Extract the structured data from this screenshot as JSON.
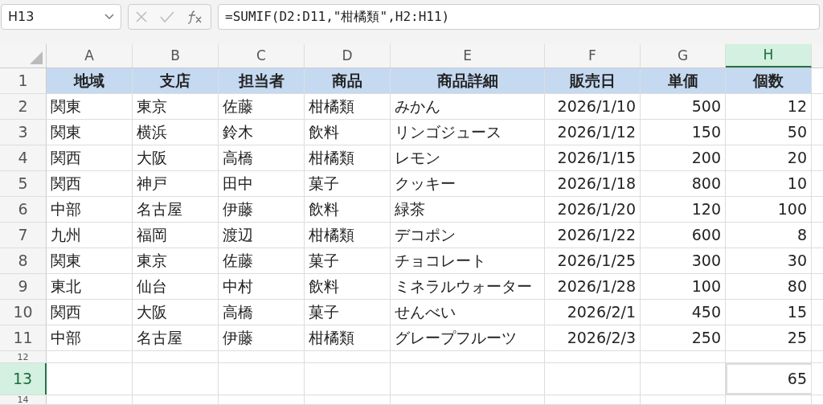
{
  "name_box": "H13",
  "formula_bar": {
    "cancel_enabled": false,
    "formula": "=SUMIF(D2:D11,\"柑橘類\",H2:H11)"
  },
  "columns": [
    {
      "letter": "A",
      "selected": false,
      "kind": "text"
    },
    {
      "letter": "B",
      "selected": false,
      "kind": "text"
    },
    {
      "letter": "C",
      "selected": false,
      "kind": "text"
    },
    {
      "letter": "D",
      "selected": false,
      "kind": "text"
    },
    {
      "letter": "E",
      "selected": false,
      "kind": "text"
    },
    {
      "letter": "F",
      "selected": false,
      "kind": "number"
    },
    {
      "letter": "G",
      "selected": false,
      "kind": "number"
    },
    {
      "letter": "H",
      "selected": true,
      "kind": "number"
    }
  ],
  "rows": [
    {
      "number": "1",
      "selected": false,
      "kind": "header",
      "cells": [
        "地域",
        "支店",
        "担当者",
        "商品",
        "商品詳細",
        "販売日",
        "単価",
        "個数"
      ]
    },
    {
      "number": "2",
      "selected": false,
      "kind": "data",
      "cells": [
        "関東",
        "東京",
        "佐藤",
        "柑橘類",
        "みかん",
        "2026/1/10",
        "500",
        "12"
      ]
    },
    {
      "number": "3",
      "selected": false,
      "kind": "data",
      "cells": [
        "関東",
        "横浜",
        "鈴木",
        "飲料",
        "リンゴジュース",
        "2026/1/12",
        "150",
        "50"
      ]
    },
    {
      "number": "4",
      "selected": false,
      "kind": "data",
      "cells": [
        "関西",
        "大阪",
        "高橋",
        "柑橘類",
        "レモン",
        "2026/1/15",
        "200",
        "20"
      ]
    },
    {
      "number": "5",
      "selected": false,
      "kind": "data",
      "cells": [
        "関西",
        "神戸",
        "田中",
        "菓子",
        "クッキー",
        "2026/1/18",
        "800",
        "10"
      ]
    },
    {
      "number": "6",
      "selected": false,
      "kind": "data",
      "cells": [
        "中部",
        "名古屋",
        "伊藤",
        "飲料",
        "緑茶",
        "2026/1/20",
        "120",
        "100"
      ]
    },
    {
      "number": "7",
      "selected": false,
      "kind": "data",
      "cells": [
        "九州",
        "福岡",
        "渡辺",
        "柑橘類",
        "デコポン",
        "2026/1/22",
        "600",
        "8"
      ]
    },
    {
      "number": "8",
      "selected": false,
      "kind": "data",
      "cells": [
        "関東",
        "東京",
        "佐藤",
        "菓子",
        "チョコレート",
        "2026/1/25",
        "300",
        "30"
      ]
    },
    {
      "number": "9",
      "selected": false,
      "kind": "data",
      "cells": [
        "東北",
        "仙台",
        "中村",
        "飲料",
        "ミネラルウォーター",
        "2026/1/28",
        "100",
        "80"
      ]
    },
    {
      "number": "10",
      "selected": false,
      "kind": "data",
      "cells": [
        "関西",
        "大阪",
        "高橋",
        "菓子",
        "せんべい",
        "2026/2/1",
        "450",
        "15"
      ]
    },
    {
      "number": "11",
      "selected": false,
      "kind": "data",
      "cells": [
        "中部",
        "名古屋",
        "伊藤",
        "柑橘類",
        "グレープフルーツ",
        "2026/2/3",
        "250",
        "25"
      ]
    },
    {
      "number": "12",
      "selected": false,
      "kind": "short",
      "cells": [
        "",
        "",
        "",
        "",
        "",
        "",
        "",
        ""
      ]
    },
    {
      "number": "13",
      "selected": true,
      "kind": "data",
      "cells": [
        "",
        "",
        "",
        "",
        "",
        "",
        "",
        "65"
      ]
    },
    {
      "number": "14",
      "selected": false,
      "kind": "edge",
      "cells": [
        "",
        "",
        "",
        "",
        "",
        "",
        "",
        ""
      ]
    }
  ]
}
